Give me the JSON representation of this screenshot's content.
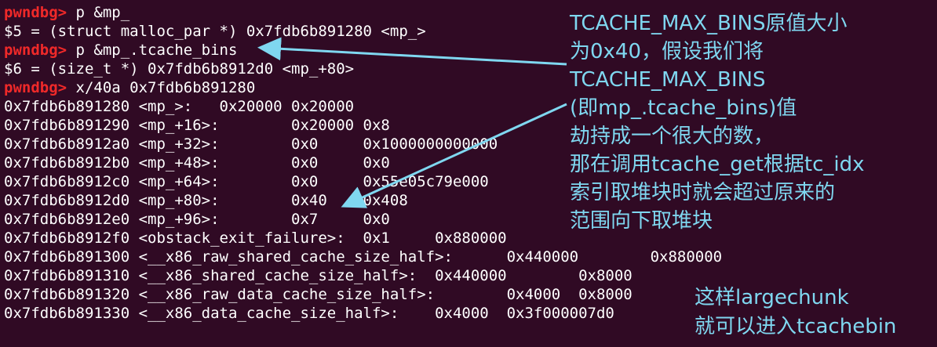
{
  "terminal": {
    "prompt": "pwndbg>",
    "lines": [
      {
        "kind": "cmd",
        "text": " p &mp_"
      },
      {
        "kind": "out",
        "text": "$5 = (struct malloc_par *) 0x7fdb6b891280 <mp_>"
      },
      {
        "kind": "cmd",
        "text": " p &mp_.tcache_bins"
      },
      {
        "kind": "out",
        "text": "$6 = (size_t *) 0x7fdb6b8912d0 <mp_+80>"
      },
      {
        "kind": "cmd",
        "text": " x/40a 0x7fdb6b891280"
      },
      {
        "kind": "out",
        "text": "0x7fdb6b891280 <mp_>:   0x20000 0x20000"
      },
      {
        "kind": "out",
        "text": "0x7fdb6b891290 <mp_+16>:        0x20000 0x8"
      },
      {
        "kind": "out",
        "text": "0x7fdb6b8912a0 <mp_+32>:        0x0     0x1000000000000"
      },
      {
        "kind": "out",
        "text": "0x7fdb6b8912b0 <mp_+48>:        0x0     0x0"
      },
      {
        "kind": "out",
        "text": "0x7fdb6b8912c0 <mp_+64>:        0x0     0x55e05c79e000"
      },
      {
        "kind": "out",
        "text": "0x7fdb6b8912d0 <mp_+80>:        0x40    0x408"
      },
      {
        "kind": "out",
        "text": "0x7fdb6b8912e0 <mp_+96>:        0x7     0x0"
      },
      {
        "kind": "out",
        "text": "0x7fdb6b8912f0 <obstack_exit_failure>:  0x1     0x880000"
      },
      {
        "kind": "out",
        "text": "0x7fdb6b891300 <__x86_raw_shared_cache_size_half>:      0x440000        0x880000"
      },
      {
        "kind": "out",
        "text": "0x7fdb6b891310 <__x86_shared_cache_size_half>:  0x440000        0x8000"
      },
      {
        "kind": "out",
        "text": "0x7fdb6b891320 <__x86_raw_data_cache_size_half>:        0x4000  0x8000"
      },
      {
        "kind": "out",
        "text": "0x7fdb6b891330 <__x86_data_cache_size_half>:    0x4000  0x3f000007d0"
      }
    ]
  },
  "annotations": {
    "main": [
      "TCACHE_MAX_BINS原值大小",
      "为0x40，假设我们将",
      "TCACHE_MAX_BINS",
      "(即mp_.tcache_bins)值",
      "劫持成一个很大的数，",
      "那在调用tcache_get根据tc_idx",
      "索引取堆块时就会超过原来的",
      "范围向下取堆块"
    ],
    "side": [
      "这样largechunk",
      "就可以进入tcachebin"
    ]
  },
  "colors": {
    "background": "#300a24",
    "prompt": "#ef2929",
    "text": "#ffffff",
    "annotation": "#7fd7f0"
  }
}
